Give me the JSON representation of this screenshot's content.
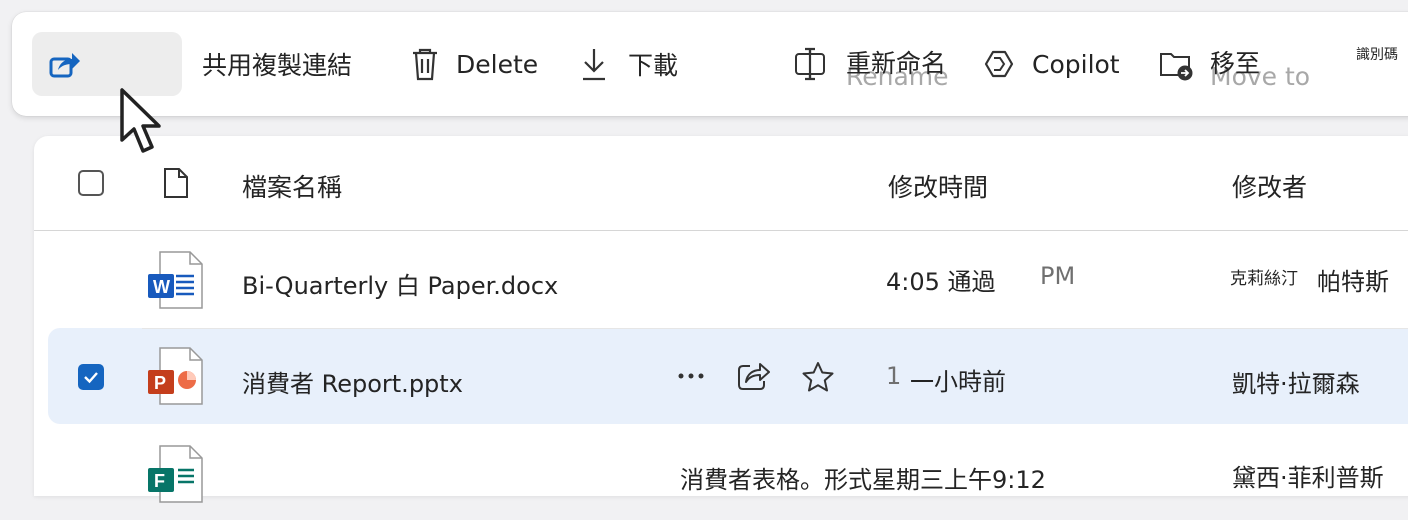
{
  "toolbar": {
    "share_overlay": "共用",
    "copy_link": "複製連結",
    "delete": "Delete",
    "download": "下載",
    "rename": "重新命名",
    "rename_ghost": "Rename",
    "copilot": "Copilot",
    "move_to": "移至",
    "move_to_ghost": "Move to",
    "code_label": "識別碼"
  },
  "columns": {
    "name": "檔案名稱",
    "modified": "修改時間",
    "modified_by": "修改者"
  },
  "files": [
    {
      "name": "Bi-Quarterly 白 Paper.docx",
      "type_letter": "W",
      "modified_time": "4:05 通過",
      "modified_suffix": "PM",
      "modified_by_small": "克莉絲汀",
      "modified_by": "帕特斯",
      "selected": false,
      "color": "#185abd"
    },
    {
      "name": "消費者 Report.pptx",
      "type_letter": "P",
      "modified_num": "1",
      "modified_time": "一小時前",
      "modified_by": "凱特·拉爾森",
      "selected": true,
      "color": "#c43e1c"
    },
    {
      "name": "消費者表格。形式星期三上午9:12",
      "type_letter": "F",
      "modified_by": "黛西·菲利普斯",
      "selected": false,
      "color": "#077568"
    }
  ],
  "colors": {
    "accent": "#1565c0",
    "selected_row": "#e8f0fb",
    "word": "#185abd",
    "powerpoint": "#c43e1c",
    "forms": "#077568"
  }
}
